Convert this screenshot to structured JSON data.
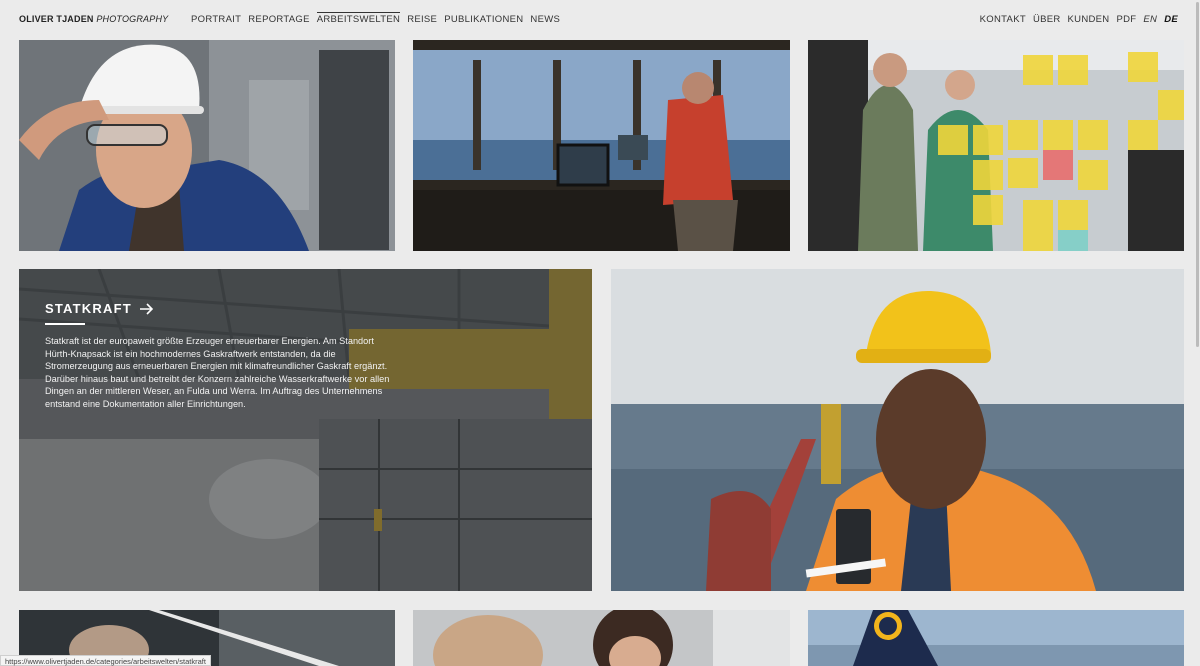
{
  "header": {
    "logo_name": "OLIVER TJADEN",
    "logo_suffix": "PHOTOGRAPHY",
    "nav_main": [
      "PORTRAIT",
      "REPORTAGE",
      "ARBEITSWELTEN",
      "REISE",
      "PUBLIKATIONEN",
      "NEWS"
    ],
    "nav_active": "ARBEITSWELTEN",
    "nav_right": [
      "KONTAKT",
      "ÜBER",
      "KUNDEN",
      "PDF",
      "EN",
      "DE"
    ]
  },
  "feature": {
    "title": "STATKRAFT",
    "description": "Statkraft ist der europaweit größte Erzeuger erneuerbarer Energien. Am Standort Hürth-Knapsack ist ein hochmodernes Gaskraftwerk entstanden, da die Stromerzeugung aus erneuerbaren Energien mit klimafreundlicher Gaskraft ergänzt. Darüber hinaus baut und betreibt der Konzern zahlreiche Wasserkraftwerke vor allen Dingen an der mittleren Weser, an Fulda und Werra. Im Auftrag des Unternehmens entstand eine Dokumentation aller Einrichtungen."
  },
  "status_url": "https://www.olivertjaden.de/categories/arbeitswelten/statkraft",
  "colors": {
    "background": "#ebebeb",
    "hardhat_yellow": "#f2c21a",
    "vest_orange": "#f08a2a"
  }
}
